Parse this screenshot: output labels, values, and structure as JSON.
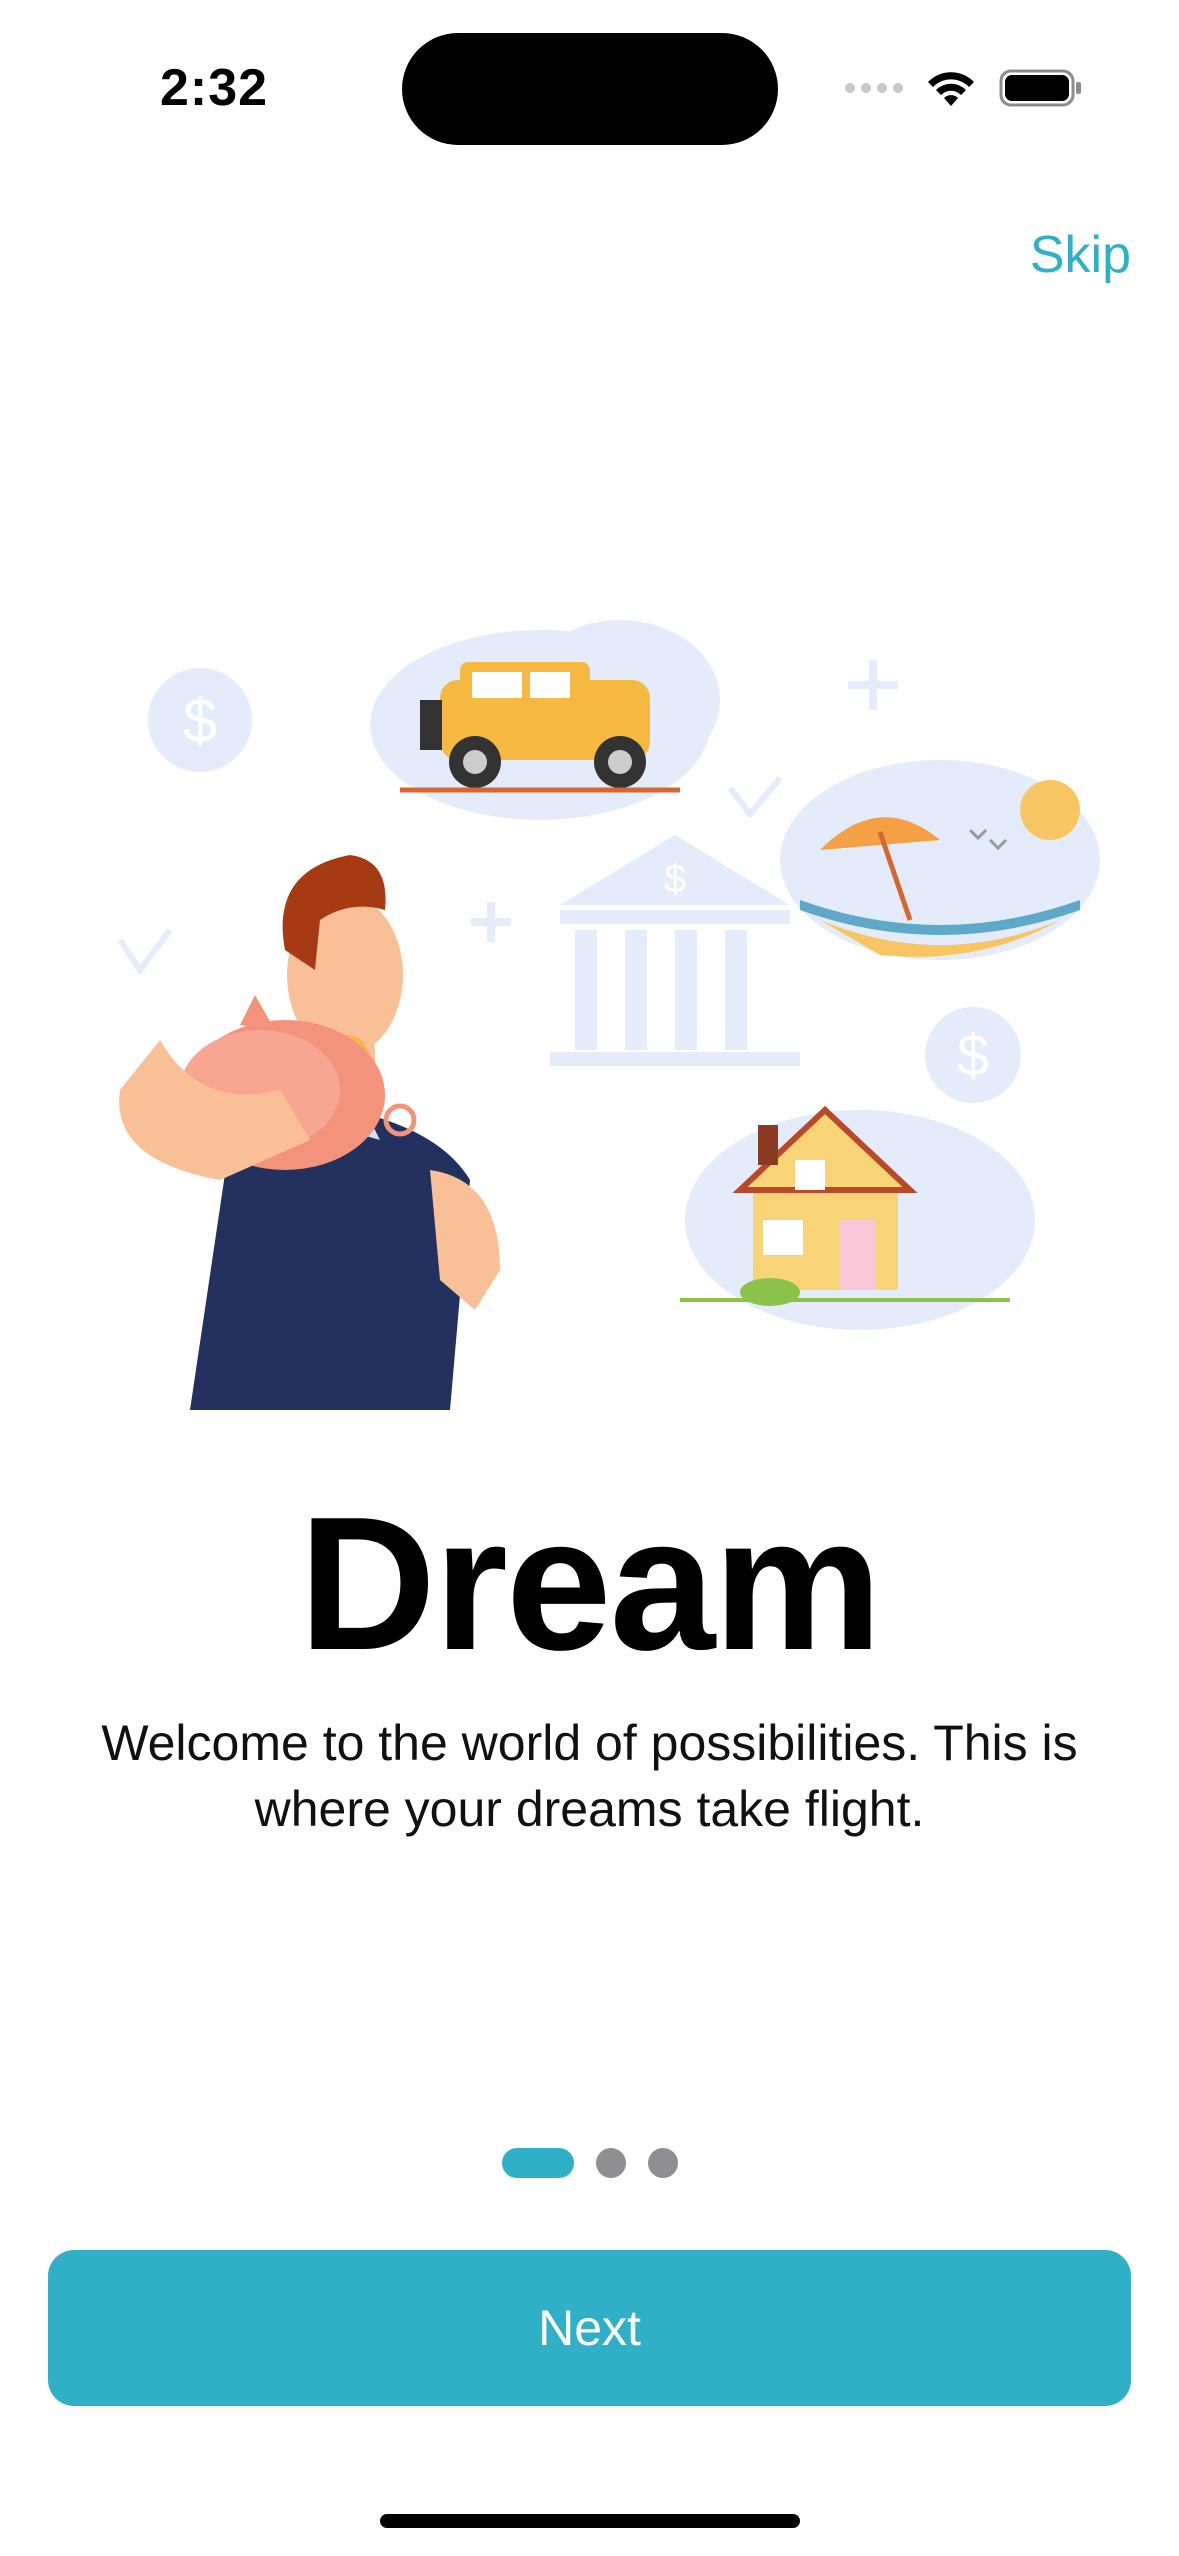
{
  "status_bar": {
    "time": "2:32",
    "icons": [
      "cellular-signal-icon",
      "wifi-icon",
      "battery-icon"
    ]
  },
  "header": {
    "skip_label": "Skip"
  },
  "illustration": {
    "description_icon": "saving-dreams-illustration"
  },
  "content": {
    "title": "Dream",
    "subtitle": "Welcome to the world of possibilities. This is where your dreams take flight."
  },
  "pagination": {
    "current_page": 1,
    "total_pages": 3
  },
  "actions": {
    "next_label": "Next"
  },
  "colors": {
    "accent": "#30b0c7",
    "inactive_dot": "#8e8e93",
    "cloud": "#e4ecfb"
  }
}
